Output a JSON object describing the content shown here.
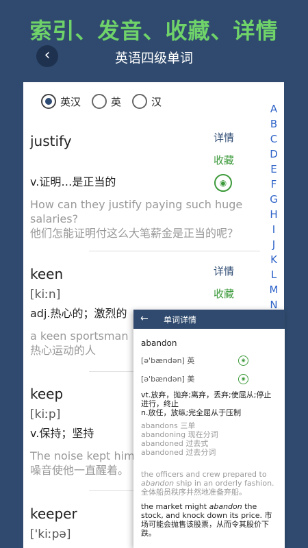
{
  "promo": {
    "title": "索引、发音、收藏、详情"
  },
  "header": {
    "back_icon": "‹",
    "title": "英语四级单词"
  },
  "filter": {
    "options": [
      "英汉",
      "英",
      "汉"
    ],
    "selected": 0
  },
  "alphabet": [
    "A",
    "B",
    "C",
    "D",
    "E",
    "F",
    "G",
    "H",
    "I",
    "J",
    "K",
    "L",
    "M",
    "N"
  ],
  "actions": {
    "detail": "详情",
    "favorite": "收藏",
    "audio_icon": "speaker-icon"
  },
  "entries": [
    {
      "word": "justify",
      "phonetic": "",
      "meaning": "v.证明…是正当的",
      "example_en": "How can they justify paying such huge salaries?",
      "example_zh": "他们怎能证明付这么大笔薪金是正当的呢？"
    },
    {
      "word": "keen",
      "phonetic": "[kiːn]",
      "meaning": "adj.热心的；激烈的",
      "example_en": "a keen sportsman",
      "example_zh": "热心运动的人"
    },
    {
      "word": "keep",
      "phonetic": "[kiːp]",
      "meaning": "v.保持；坚持",
      "example_en": "The noise kept him",
      "example_zh": "噪音使他一直醒着。"
    },
    {
      "word": "keeper",
      "phonetic": "['kiːpə]",
      "meaning": "",
      "example_en": "",
      "example_zh": ""
    }
  ],
  "popup": {
    "back_icon": "←",
    "title": "单词详情",
    "word": "abandon",
    "phonetic_uk": "[ə'bændən] 英",
    "phonetic_us": "[ə'bændən] 美",
    "meaning_1": "vt.放弃，抛弃;离弃，丢弃;使屈从;停止进行，终止",
    "meaning_2": "n.放任，放纵;完全屈从于压制",
    "forms": [
      "abandons  三单",
      "abandoning  现在分词",
      "abandoned  过去式",
      "abandoned  过去分词"
    ],
    "example_1_pre": "the officers and crew prepared to ",
    "example_1_em": "abandon",
    "example_1_post": " ship in an orderly fashion.",
    "example_1_zh": "全体船员秩序井然地准备弃船。",
    "example_2_pre": "the market might ",
    "example_2_em": "abandon",
    "example_2_post": " the stock, and knock down its price. 市场可能会抛售该股票，从而令其股价下跌。"
  }
}
